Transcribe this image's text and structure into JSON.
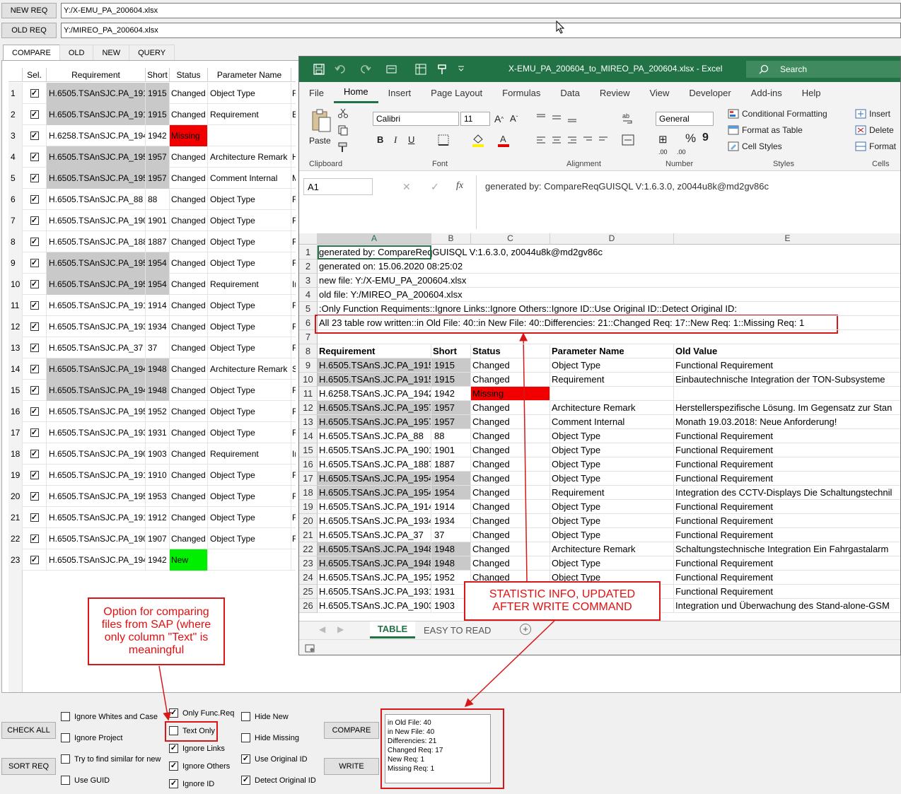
{
  "top": {
    "new_req_btn": "NEW REQ",
    "new_req_path": "Y:/X-EMU_PA_200604.xlsx",
    "old_req_btn": "OLD REQ",
    "old_req_path": "Y:/MIREO_PA_200604.xlsx"
  },
  "tabs": [
    "COMPARE",
    "OLD",
    "NEW",
    "QUERY"
  ],
  "table": {
    "headers": [
      "Sel.",
      "Requirement",
      "Short",
      "Status",
      "Parameter Name"
    ],
    "rows": [
      {
        "n": "1",
        "req": "H.6505.TSAnSJC.PA_1915",
        "short": "1915",
        "status": "Changed",
        "param": "Object Type",
        "edge": "F"
      },
      {
        "n": "2",
        "req": "H.6505.TSAnSJC.PA_1915",
        "short": "1915",
        "status": "Changed",
        "param": "Requirement",
        "edge": "E"
      },
      {
        "n": "3",
        "req": "H.6258.TSAnSJC.PA_1942",
        "short": "1942",
        "status": "Missing",
        "param": "",
        "edge": ""
      },
      {
        "n": "4",
        "req": "H.6505.TSAnSJC.PA_1957",
        "short": "1957",
        "status": "Changed",
        "param": "Architecture Remark",
        "edge": "H"
      },
      {
        "n": "5",
        "req": "H.6505.TSAnSJC.PA_1957",
        "short": "1957",
        "status": "Changed",
        "param": "Comment Internal",
        "edge": "M"
      },
      {
        "n": "6",
        "req": "H.6505.TSAnSJC.PA_88",
        "short": "88",
        "status": "Changed",
        "param": "Object Type",
        "edge": "F"
      },
      {
        "n": "7",
        "req": "H.6505.TSAnSJC.PA_1901",
        "short": "1901",
        "status": "Changed",
        "param": "Object Type",
        "edge": "F"
      },
      {
        "n": "8",
        "req": "H.6505.TSAnSJC.PA_1887",
        "short": "1887",
        "status": "Changed",
        "param": "Object Type",
        "edge": "F"
      },
      {
        "n": "9",
        "req": "H.6505.TSAnSJC.PA_1954",
        "short": "1954",
        "status": "Changed",
        "param": "Object Type",
        "edge": "F"
      },
      {
        "n": "10",
        "req": "H.6505.TSAnSJC.PA_1954",
        "short": "1954",
        "status": "Changed",
        "param": "Requirement",
        "edge": "In"
      },
      {
        "n": "11",
        "req": "H.6505.TSAnSJC.PA_1914",
        "short": "1914",
        "status": "Changed",
        "param": "Object Type",
        "edge": "F"
      },
      {
        "n": "12",
        "req": "H.6505.TSAnSJC.PA_1934",
        "short": "1934",
        "status": "Changed",
        "param": "Object Type",
        "edge": "F"
      },
      {
        "n": "13",
        "req": "H.6505.TSAnSJC.PA_37",
        "short": "37",
        "status": "Changed",
        "param": "Object Type",
        "edge": "F"
      },
      {
        "n": "14",
        "req": "H.6505.TSAnSJC.PA_1948",
        "short": "1948",
        "status": "Changed",
        "param": "Architecture Remark",
        "edge": "S"
      },
      {
        "n": "15",
        "req": "H.6505.TSAnSJC.PA_1948",
        "short": "1948",
        "status": "Changed",
        "param": "Object Type",
        "edge": "F"
      },
      {
        "n": "16",
        "req": "H.6505.TSAnSJC.PA_1952",
        "short": "1952",
        "status": "Changed",
        "param": "Object Type",
        "edge": "F"
      },
      {
        "n": "17",
        "req": "H.6505.TSAnSJC.PA_1931",
        "short": "1931",
        "status": "Changed",
        "param": "Object Type",
        "edge": "F"
      },
      {
        "n": "18",
        "req": "H.6505.TSAnSJC.PA_1903",
        "short": "1903",
        "status": "Changed",
        "param": "Requirement",
        "edge": "In"
      },
      {
        "n": "19",
        "req": "H.6505.TSAnSJC.PA_1910",
        "short": "1910",
        "status": "Changed",
        "param": "Object Type",
        "edge": "F"
      },
      {
        "n": "20",
        "req": "H.6505.TSAnSJC.PA_1953",
        "short": "1953",
        "status": "Changed",
        "param": "Object Type",
        "edge": "F"
      },
      {
        "n": "21",
        "req": "H.6505.TSAnSJC.PA_1912",
        "short": "1912",
        "status": "Changed",
        "param": "Object Type",
        "edge": "F"
      },
      {
        "n": "22",
        "req": "H.6505.TSAnSJC.PA_1907",
        "short": "1907",
        "status": "Changed",
        "param": "Object Type",
        "edge": "F"
      },
      {
        "n": "23",
        "req": "H.6505.TSAnSJC.PA_1942",
        "short": "1942",
        "status": "New",
        "param": "",
        "edge": ""
      }
    ]
  },
  "options": {
    "check_all": "CHECK ALL",
    "sort_req": "SORT REQ",
    "compare": "COMPARE",
    "write": "WRITE",
    "ignore_whites": "Ignore Whites and Case",
    "ignore_project": "Ignore Project",
    "try_similar": "Try to find similar for new",
    "use_guid": "Use GUID",
    "only_func": "Only Func.Req",
    "text_only": "Text Only",
    "ignore_links": "Ignore Links",
    "ignore_others": "Ignore Others",
    "ignore_id": "Ignore ID",
    "hide_new": "Hide New",
    "hide_missing": "Hide Missing",
    "use_original_id": "Use Original ID",
    "detect_original_id": "Detect Original ID"
  },
  "stats": [
    "in Old File: 40",
    "in New File: 40",
    "Differencies: 21",
    "Changed Req: 17",
    "New Req: 1",
    "Missing Req: 1"
  ],
  "callouts": {
    "sap": "Option for comparing files from SAP (where only column \"Text\" is meaningful",
    "statistic": "STATISTIC INFO, UPDATED AFTER WRITE COMMAND"
  },
  "excel": {
    "title": "X-EMU_PA_200604_to_MIREO_PA_200604.xlsx  -  Excel",
    "search": "Search",
    "menu": [
      "File",
      "Home",
      "Insert",
      "Page Layout",
      "Formulas",
      "Data",
      "Review",
      "View",
      "Developer",
      "Add-ins",
      "Help"
    ],
    "ribbon": {
      "paste": "Paste",
      "clipboard": "Clipboard",
      "font_name": "Calibri",
      "font_size": "11",
      "font": "Font",
      "alignment": "Alignment",
      "number_format": "General",
      "number": "Number",
      "cond_format": "Conditional Formatting",
      "format_table": "Format as Table",
      "cell_styles": "Cell Styles",
      "styles": "Styles",
      "insert": "Insert",
      "delete": "Delete",
      "format": "Format",
      "cells": "Cells"
    },
    "namebox": "A1",
    "fx": "fx",
    "formula": "generated by: CompareReqGUISQL V:1.6.3.0, z0044u8k@md2gv86c",
    "cols": [
      "A",
      "B",
      "C",
      "D",
      "E"
    ],
    "info_rows": [
      {
        "n": "1",
        "text": "generated by: CompareReqGUISQL V:1.6.3.0, z0044u8k@md2gv86c"
      },
      {
        "n": "2",
        "text": "generated on: 15.06.2020 08:25:02"
      },
      {
        "n": "3",
        "text": "new file: Y:/X-EMU_PA_200604.xlsx"
      },
      {
        "n": "4",
        "text": "old file: Y:/MIREO_PA_200604.xlsx"
      },
      {
        "n": "5",
        "text": ":Only Function Requiments::Ignore Links::Ignore Others::Ignore ID::Use Original ID::Detect Original ID:"
      },
      {
        "n": "6",
        "text": "All 23 table row written::in Old File: 40::in New File: 40::Differencies: 21::Changed Req: 17::New Req: 1::Missing Req: 1"
      },
      {
        "n": "7",
        "text": ""
      }
    ],
    "header_row": {
      "n": "8",
      "cells": [
        "Requirement",
        "Short",
        "Status",
        "Parameter Name",
        "Old Value"
      ]
    },
    "data_rows": [
      {
        "n": "9",
        "a": "H.6505.TSAnS.JC.PA_1915",
        "b": "1915",
        "c": "Changed",
        "d": "Object Type",
        "e": "Functional Requirement",
        "g": 1
      },
      {
        "n": "10",
        "a": "H.6505.TSAnS.JC.PA_1915",
        "b": "1915",
        "c": "Changed",
        "d": "Requirement",
        "e": "Einbautechnische Integration der TON-Subsysteme",
        "g": 1
      },
      {
        "n": "11",
        "a": "H.6258.TSAnS.JC.PA_1942",
        "b": "1942",
        "c": "Missing",
        "d": "",
        "e": "",
        "g": 0,
        "m": 1
      },
      {
        "n": "12",
        "a": "H.6505.TSAnS.JC.PA_1957",
        "b": "1957",
        "c": "Changed",
        "d": "Architecture Remark",
        "e": "Herstellerspezifische Lösung. Im Gegensatz zur Stan",
        "g": 1
      },
      {
        "n": "13",
        "a": "H.6505.TSAnS.JC.PA_1957",
        "b": "1957",
        "c": "Changed",
        "d": "Comment Internal",
        "e": "Monath 19.03.2018: Neue Anforderung!",
        "g": 1
      },
      {
        "n": "14",
        "a": "H.6505.TSAnS.JC.PA_88",
        "b": "88",
        "c": "Changed",
        "d": "Object Type",
        "e": "Functional Requirement",
        "g": 0
      },
      {
        "n": "15",
        "a": "H.6505.TSAnS.JC.PA_1901",
        "b": "1901",
        "c": "Changed",
        "d": "Object Type",
        "e": "Functional Requirement",
        "g": 0
      },
      {
        "n": "16",
        "a": "H.6505.TSAnS.JC.PA_1887",
        "b": "1887",
        "c": "Changed",
        "d": "Object Type",
        "e": "Functional Requirement",
        "g": 0
      },
      {
        "n": "17",
        "a": "H.6505.TSAnS.JC.PA_1954",
        "b": "1954",
        "c": "Changed",
        "d": "Object Type",
        "e": "Functional Requirement",
        "g": 1
      },
      {
        "n": "18",
        "a": "H.6505.TSAnS.JC.PA_1954",
        "b": "1954",
        "c": "Changed",
        "d": "Requirement",
        "e": "Integration des CCTV-Displays Die Schaltungstechnil",
        "g": 1
      },
      {
        "n": "19",
        "a": "H.6505.TSAnS.JC.PA_1914",
        "b": "1914",
        "c": "Changed",
        "d": "Object Type",
        "e": "Functional Requirement",
        "g": 0
      },
      {
        "n": "20",
        "a": "H.6505.TSAnS.JC.PA_1934",
        "b": "1934",
        "c": "Changed",
        "d": "Object Type",
        "e": "Functional Requirement",
        "g": 0
      },
      {
        "n": "21",
        "a": "H.6505.TSAnS.JC.PA_37",
        "b": "37",
        "c": "Changed",
        "d": "Object Type",
        "e": "Functional Requirement",
        "g": 0
      },
      {
        "n": "22",
        "a": "H.6505.TSAnS.JC.PA_1948",
        "b": "1948",
        "c": "Changed",
        "d": "Architecture Remark",
        "e": "Schaltungstechnische Integration  Ein  Fahrgastalarm",
        "g": 1
      },
      {
        "n": "23",
        "a": "H.6505.TSAnS.JC.PA_1948",
        "b": "1948",
        "c": "Changed",
        "d": "Object Type",
        "e": "Functional Requirement",
        "g": 1
      },
      {
        "n": "24",
        "a": "H.6505.TSAnS.JC.PA_1952",
        "b": "1952",
        "c": "Changed",
        "d": "Object Type",
        "e": "Functional Requirement",
        "g": 0
      },
      {
        "n": "25",
        "a": "H.6505.TSAnS.JC.PA_1931",
        "b": "1931",
        "c": "Changed",
        "d": "Object Type",
        "e": "Functional Requirement",
        "g": 0
      },
      {
        "n": "26",
        "a": "H.6505.TSAnS.JC.PA_1903",
        "b": "1903",
        "c": "Changed",
        "d": "Requirement",
        "e": "Integration und Überwachung des Stand-alone-GSM",
        "g": 0
      }
    ],
    "sheet_tabs": [
      "TABLE",
      "EASY TO READ"
    ]
  }
}
